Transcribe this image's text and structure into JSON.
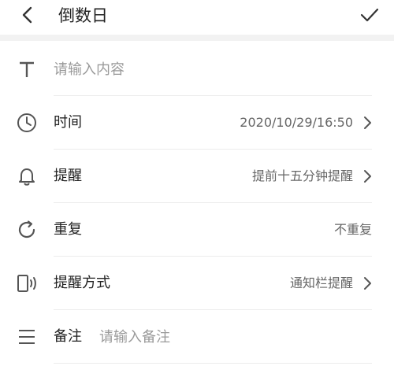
{
  "header": {
    "title": "倒数日",
    "back_icon": "chevron-left-icon",
    "confirm_icon": "checkmark-icon"
  },
  "form": {
    "title_field": {
      "icon": "text-T-icon",
      "placeholder": "请输入内容",
      "value": ""
    },
    "time": {
      "icon": "clock-icon",
      "label": "时间",
      "value": "2020/10/29/16:50"
    },
    "reminder": {
      "icon": "bell-icon",
      "label": "提醒",
      "value": "提前十五分钟提醒"
    },
    "repeat": {
      "icon": "repeat-circle-icon",
      "label": "重复",
      "value": "不重复"
    },
    "reminder_method": {
      "icon": "phone-vibrate-icon",
      "label": "提醒方式",
      "value": "通知栏提醒"
    },
    "note": {
      "icon": "menu-lines-icon",
      "label": "备注",
      "placeholder": "请输入备注",
      "value": ""
    }
  },
  "colors": {
    "icon": "#555555",
    "text": "#222222",
    "secondary_text": "#666666",
    "placeholder": "#9a9a9a",
    "separator": "#ececec",
    "band": "#f2f2f2"
  }
}
